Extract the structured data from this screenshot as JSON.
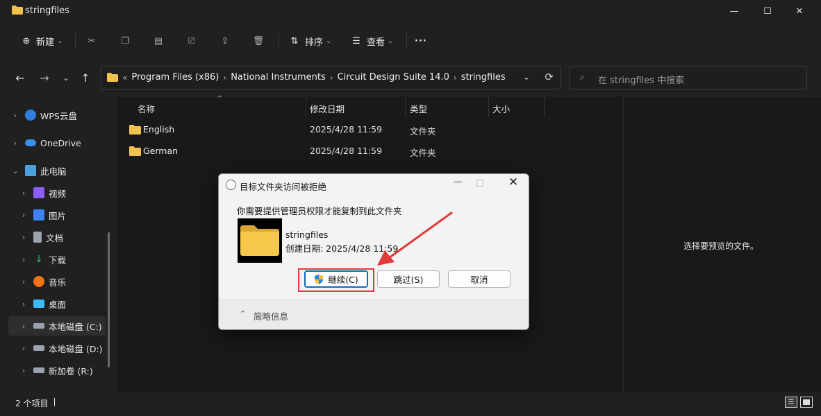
{
  "window": {
    "title": "stringfiles"
  },
  "toolbar": {
    "new_label": "新建",
    "sort_label": "排序",
    "view_label": "查看",
    "more_label": "···"
  },
  "address": {
    "crumbs": [
      "Program Files (x86)",
      "National Instruments",
      "Circuit Design Suite 14.0",
      "stringfiles"
    ],
    "overflow": "«"
  },
  "search": {
    "placeholder": "在 stringfiles 中搜索"
  },
  "sidebar": {
    "items": [
      {
        "label": "WPS云盘",
        "icon": "cloud-icon",
        "color": "#2f7de1"
      },
      {
        "label": "OneDrive",
        "icon": "onedrive-icon",
        "color": "#3a8ee6"
      },
      {
        "label": "此电脑",
        "icon": "computer-icon",
        "color": "#4aa3df"
      },
      {
        "label": "视频",
        "icon": "video-icon",
        "color": "#8b5cf6"
      },
      {
        "label": "图片",
        "icon": "pictures-icon",
        "color": "#3b82f6"
      },
      {
        "label": "文档",
        "icon": "documents-icon",
        "color": "#9ca3af"
      },
      {
        "label": "下载",
        "icon": "download-icon",
        "color": "#22c55e"
      },
      {
        "label": "音乐",
        "icon": "music-icon",
        "color": "#f97316"
      },
      {
        "label": "桌面",
        "icon": "desktop-icon",
        "color": "#38bdf8"
      },
      {
        "label": "本地磁盘 (C:)",
        "icon": "drive-icon",
        "color": "#9ca3af"
      },
      {
        "label": "本地磁盘 (D:)",
        "icon": "drive-icon",
        "color": "#9ca3af"
      },
      {
        "label": "新加卷 (R:)",
        "icon": "drive-icon",
        "color": "#9ca3af"
      }
    ]
  },
  "columns": {
    "name": "名称",
    "modified": "修改日期",
    "type": "类型",
    "size": "大小"
  },
  "files": [
    {
      "name": "English",
      "modified": "2025/4/28 11:59",
      "type": "文件夹"
    },
    {
      "name": "German",
      "modified": "2025/4/28 11:59",
      "type": "文件夹"
    }
  ],
  "preview": {
    "message": "选择要预览的文件。"
  },
  "status": {
    "count": "2 个项目"
  },
  "dialog": {
    "title": "目标文件夹访问被拒绝",
    "message": "你需要提供管理员权限才能复制到此文件夹",
    "file_name": "stringfiles",
    "file_date": "创建日期: 2025/4/28 11:59",
    "continue_label": "继续(C)",
    "skip_label": "跳过(S)",
    "cancel_label": "取消",
    "details_label": "简略信息"
  },
  "colors": {
    "folder": "#f2c14e",
    "accent": "#0f6cbd",
    "annotation": "#e03a3a"
  }
}
